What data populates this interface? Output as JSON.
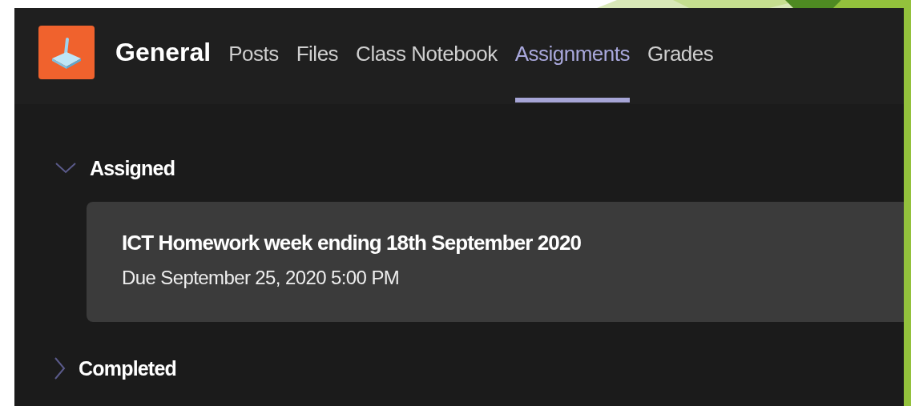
{
  "team": {
    "name": "General"
  },
  "tabs": [
    {
      "label": "Posts",
      "selected": false
    },
    {
      "label": "Files",
      "selected": false
    },
    {
      "label": "Class Notebook",
      "selected": false
    },
    {
      "label": "Assignments",
      "selected": true
    },
    {
      "label": "Grades",
      "selected": false
    }
  ],
  "sections": [
    {
      "title": "Assigned",
      "expanded": true,
      "assignments": [
        {
          "title": "ICT Homework week ending 18th September 2020",
          "due": "Due September 25, 2020 5:00 PM"
        }
      ]
    },
    {
      "title": "Completed",
      "expanded": false
    }
  ]
}
